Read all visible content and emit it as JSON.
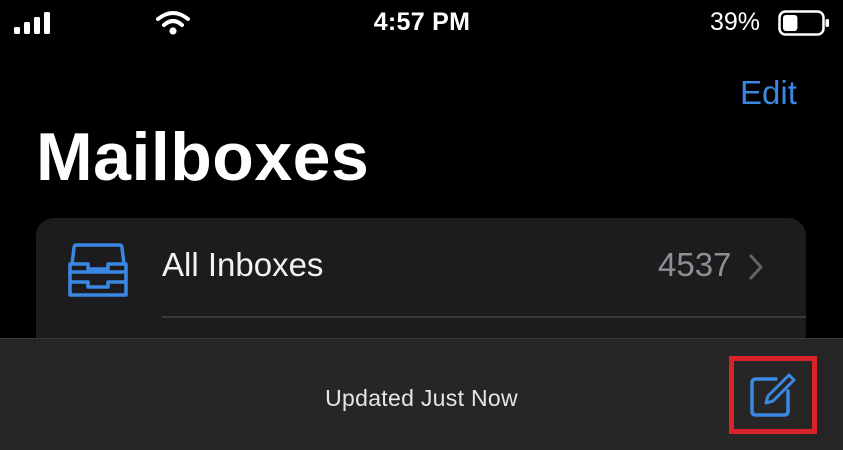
{
  "status_bar": {
    "time": "4:57 PM",
    "battery_percent": "39%",
    "battery_level": 0.39,
    "signal_icon": "cellular-signal-icon",
    "wifi_icon": "wifi-icon",
    "battery_icon": "battery-icon"
  },
  "nav": {
    "edit_label": "Edit",
    "title": "Mailboxes"
  },
  "mailboxes": [
    {
      "label": "All Inboxes",
      "count": "4537",
      "icon": "tray-icon"
    }
  ],
  "toolbar": {
    "status_text": "Updated Just Now",
    "compose_icon": "compose-icon"
  },
  "colors": {
    "background": "#000000",
    "accent": "#3a87e4",
    "card": "#1c1c1e",
    "highlight": "#d8232a"
  }
}
